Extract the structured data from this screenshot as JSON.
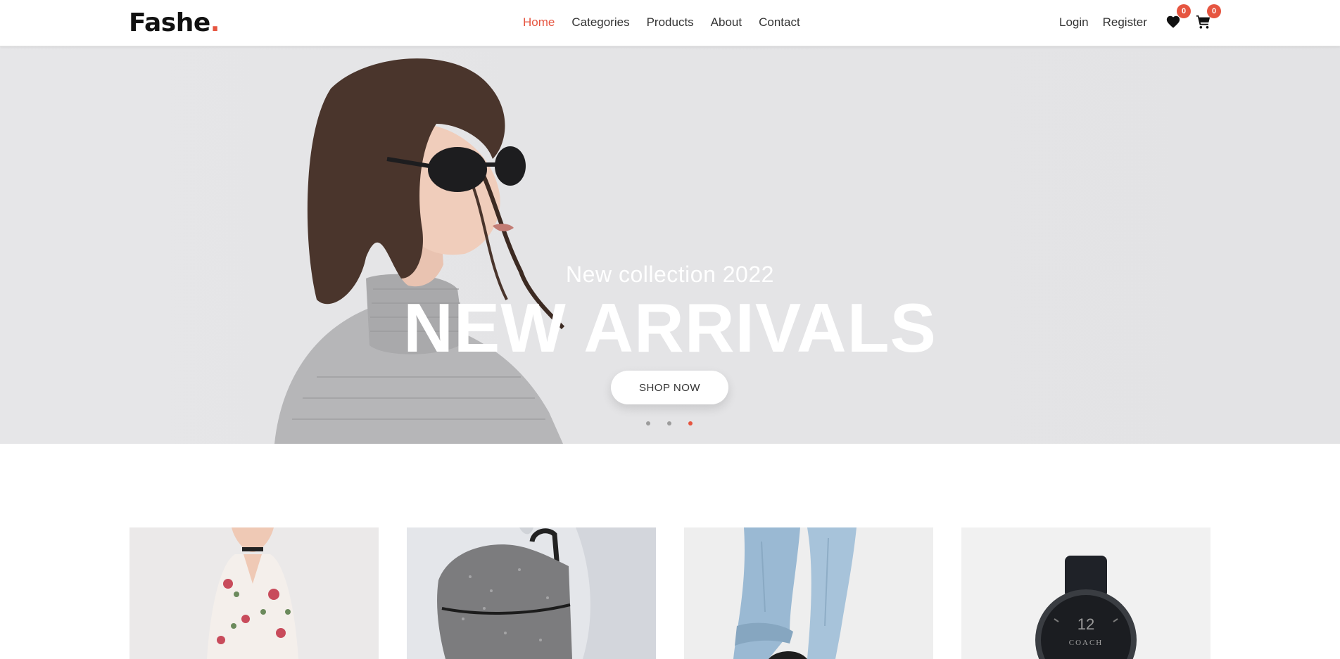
{
  "brand": {
    "name": "Fashe",
    "dot": ".",
    "accent": "#e65540"
  },
  "nav": {
    "items": [
      {
        "label": "Home",
        "active": true
      },
      {
        "label": "Categories",
        "active": false
      },
      {
        "label": "Products",
        "active": false
      },
      {
        "label": "About",
        "active": false
      },
      {
        "label": "Contact",
        "active": false
      }
    ]
  },
  "auth": {
    "login": "Login",
    "register": "Register"
  },
  "icons": {
    "wishlist": {
      "name": "heart-icon",
      "count": "0"
    },
    "cart": {
      "name": "cart-icon",
      "count": "0"
    }
  },
  "hero": {
    "subtitle": "New collection 2022",
    "title": "NEW ARRIVALS",
    "button": "SHOP NOW",
    "slides": 3,
    "active_slide": 3
  },
  "cards": [
    {
      "name": "floral-dress-photo"
    },
    {
      "name": "grey-backpack-photo"
    },
    {
      "name": "blue-jeans-photo"
    },
    {
      "name": "black-watch-photo",
      "watch_text": "12",
      "watch_brand": "COACH"
    }
  ]
}
